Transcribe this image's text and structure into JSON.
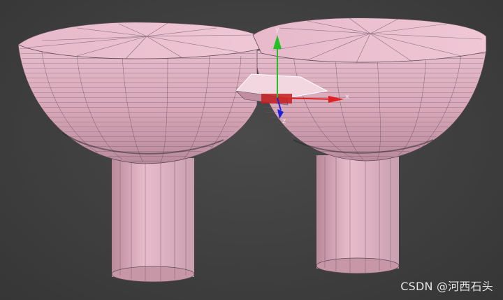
{
  "viewport": {
    "watermark": "CSDN @河西石头"
  },
  "gizmo": {
    "x_label": "x",
    "y_label": "y",
    "z_label": "z",
    "x_color": "#e02020",
    "y_color": "#22c022",
    "z_color": "#2020e0"
  },
  "model": {
    "surface_color": "#e8b7c8",
    "wire_color": "#5a4a52"
  }
}
